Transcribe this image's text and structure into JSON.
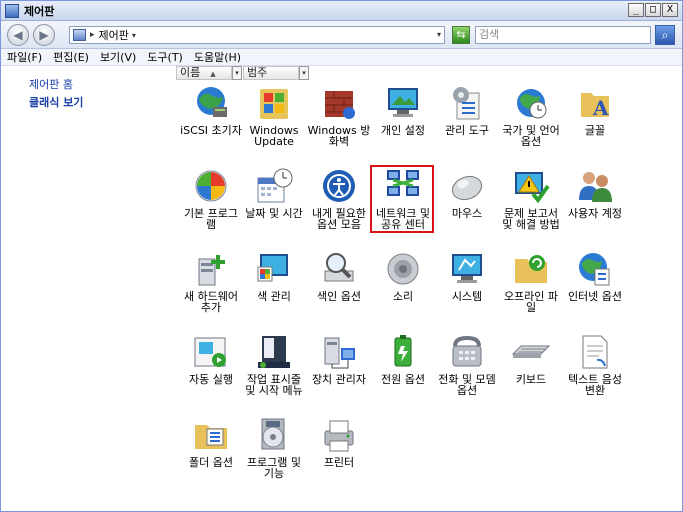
{
  "window": {
    "title": "제어판"
  },
  "window_buttons": {
    "minimize": "_",
    "maximize": "□",
    "close": "X"
  },
  "address": {
    "current": "제어판",
    "separator": "▸",
    "dropdown": "▾",
    "refresh": "⇆"
  },
  "search": {
    "placeholder": "검색",
    "button": "⌕"
  },
  "nav": {
    "back": "◀",
    "forward": "▶"
  },
  "menu": [
    "파일(F)",
    "편집(E)",
    "보기(V)",
    "도구(T)",
    "도움말(H)"
  ],
  "left_pane": {
    "home_link": "제어판 홈",
    "classic_view": "클래식 보기"
  },
  "columns": {
    "name": "이름",
    "category": "범주",
    "sort_arrow": "▲",
    "dropdown": "▾"
  },
  "items": [
    {
      "label": "iSCSI 초기자",
      "icon": "iscsi-icon"
    },
    {
      "label": "Windows Update",
      "icon": "windows-update-icon"
    },
    {
      "label": "Windows 방화벽",
      "icon": "firewall-icon"
    },
    {
      "label": "개인 설정",
      "icon": "personalization-icon"
    },
    {
      "label": "관리 도구",
      "icon": "admin-tools-icon"
    },
    {
      "label": "국가 및 언어 옵션",
      "icon": "region-language-icon"
    },
    {
      "label": "글꼴",
      "icon": "fonts-icon"
    },
    {
      "label": "기본 프로그램",
      "icon": "default-programs-icon"
    },
    {
      "label": "날짜 및 시간",
      "icon": "date-time-icon"
    },
    {
      "label": "내게 필요한 옵션 모음",
      "icon": "ease-of-access-icon"
    },
    {
      "label": "네트워크 및 공유 센터",
      "icon": "network-sharing-icon"
    },
    {
      "label": "마우스",
      "icon": "mouse-icon"
    },
    {
      "label": "문제 보고서 및 해결 방법",
      "icon": "problem-reports-icon"
    },
    {
      "label": "사용자 계정",
      "icon": "user-accounts-icon"
    },
    {
      "label": "새 하드웨어 추가",
      "icon": "add-hardware-icon"
    },
    {
      "label": "색 관리",
      "icon": "color-management-icon"
    },
    {
      "label": "색인 옵션",
      "icon": "indexing-options-icon"
    },
    {
      "label": "소리",
      "icon": "sound-icon"
    },
    {
      "label": "시스템",
      "icon": "system-icon"
    },
    {
      "label": "오프라인 파일",
      "icon": "offline-files-icon"
    },
    {
      "label": "인터넷 옵션",
      "icon": "internet-options-icon"
    },
    {
      "label": "자동 실행",
      "icon": "autoplay-icon"
    },
    {
      "label": "작업 표시줄 및 시작 메뉴",
      "icon": "taskbar-start-menu-icon"
    },
    {
      "label": "장치 관리자",
      "icon": "device-manager-icon"
    },
    {
      "label": "전원 옵션",
      "icon": "power-options-icon"
    },
    {
      "label": "전화 및 모뎀 옵션",
      "icon": "phone-modem-icon"
    },
    {
      "label": "키보드",
      "icon": "keyboard-icon"
    },
    {
      "label": "텍스트 음성 변환",
      "icon": "text-to-speech-icon"
    },
    {
      "label": "폴더 옵션",
      "icon": "folder-options-icon"
    },
    {
      "label": "프로그램 및 기능",
      "icon": "programs-features-icon"
    },
    {
      "label": "프린터",
      "icon": "printers-icon"
    }
  ],
  "highlighted_item": "네트워크 및 공유 센터",
  "colors": {
    "link": "#1a3fa6",
    "highlight_border": "#d91414",
    "title_gradient_top": "#e9eef8"
  }
}
